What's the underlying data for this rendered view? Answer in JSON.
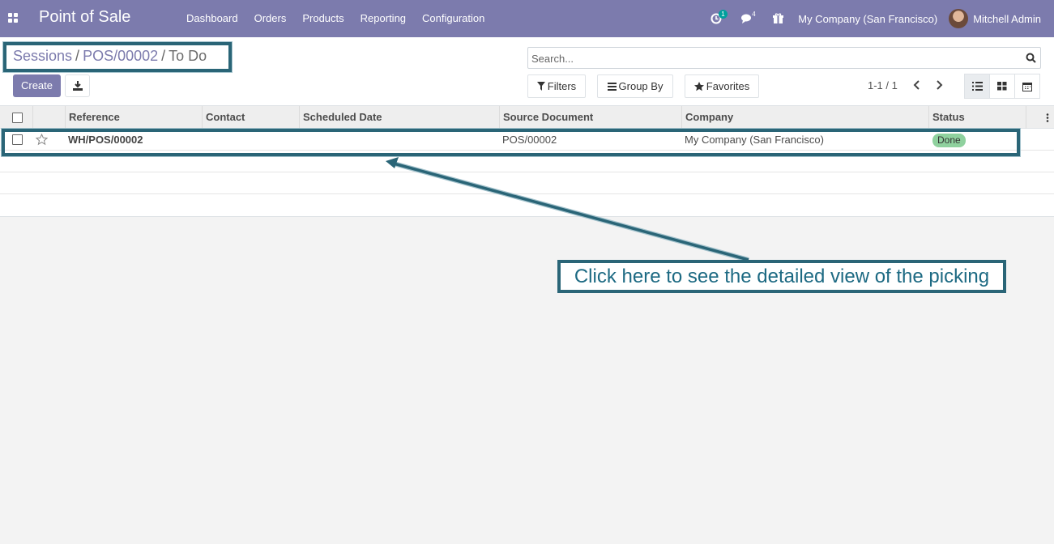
{
  "app": {
    "title": "Point of Sale"
  },
  "menu": [
    "Dashboard",
    "Orders",
    "Products",
    "Reporting",
    "Configuration"
  ],
  "systray": {
    "activity_count": "1",
    "messages_count": "4",
    "company": "My Company (San Francisco)",
    "user": "Mitchell Admin"
  },
  "breadcrumb": {
    "items": [
      "Sessions",
      "POS/00002"
    ],
    "active": "To Do",
    "separator": "/"
  },
  "buttons": {
    "create": "Create"
  },
  "search": {
    "placeholder": "Search..."
  },
  "facets": {
    "filters": "Filters",
    "group_by": "Group By",
    "favorites": "Favorites"
  },
  "pager": {
    "value": "1-1 / 1"
  },
  "table": {
    "columns": {
      "reference": "Reference",
      "contact": "Contact",
      "scheduled_date": "Scheduled Date",
      "source_document": "Source Document",
      "company": "Company",
      "status": "Status"
    },
    "rows": [
      {
        "reference": "WH/POS/00002",
        "contact": "",
        "scheduled_date": "",
        "source_document": "POS/00002",
        "company": "My Company (San Francisco)",
        "status": "Done"
      }
    ]
  },
  "annotation": {
    "callout": "Click here to see the detailed view of the picking"
  },
  "colors": {
    "brand": "#7c7bad",
    "annotation": "#2a6577",
    "status_done": "#8fd19e"
  }
}
